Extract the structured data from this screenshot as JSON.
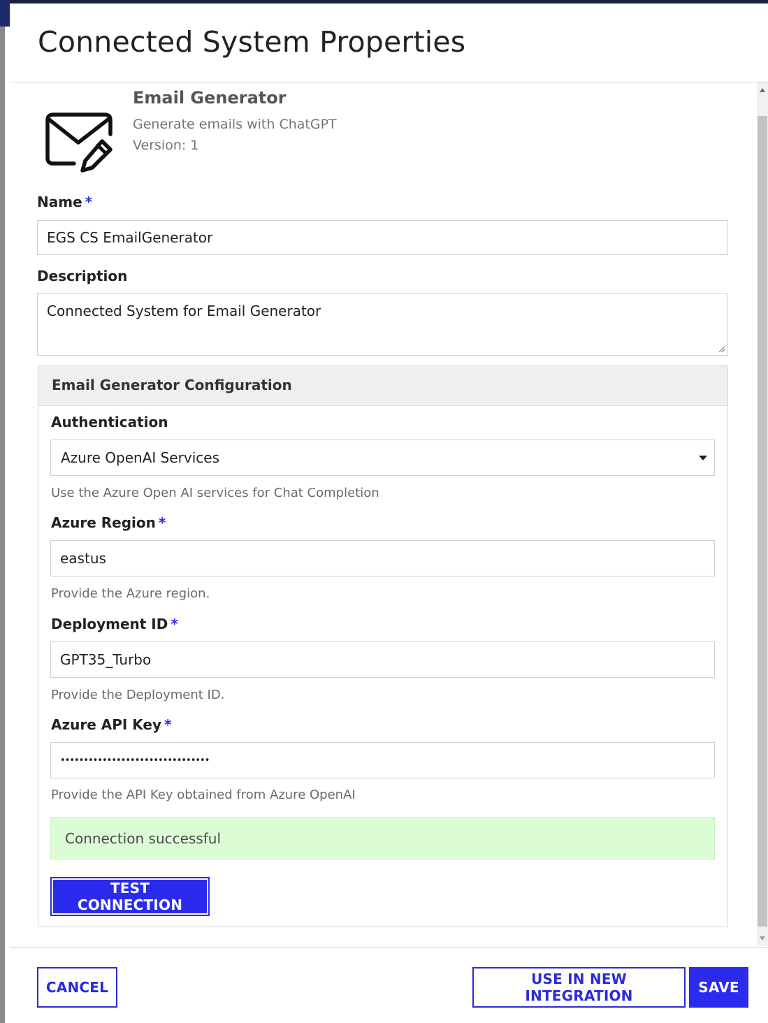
{
  "dialog": {
    "title": "Connected System Properties"
  },
  "system": {
    "icon": "envelope-pencil-icon",
    "name": "Email Generator",
    "description": "Generate emails with ChatGPT",
    "version_label": "Version: 1"
  },
  "form": {
    "name": {
      "label": "Name",
      "required_mark": "*",
      "value": "EGS CS EmailGenerator"
    },
    "description": {
      "label": "Description",
      "value": "Connected System for Email Generator"
    }
  },
  "config": {
    "title": "Email Generator Configuration",
    "authentication": {
      "label": "Authentication",
      "selected": "Azure OpenAI Services",
      "help": "Use the Azure Open AI services for Chat Completion"
    },
    "azure_region": {
      "label": "Azure Region",
      "required_mark": "*",
      "value": "eastus",
      "help": "Provide the Azure region."
    },
    "deployment_id": {
      "label": "Deployment ID",
      "required_mark": "*",
      "value": "GPT35_Turbo",
      "help": "Provide the Deployment ID."
    },
    "api_key": {
      "label": "Azure API Key",
      "required_mark": "*",
      "value": "••••••••••••••••••••••••••••••••",
      "help": "Provide the API Key obtained from Azure OpenAI"
    },
    "status_message": "Connection successful",
    "test_button": "TEST CONNECTION"
  },
  "footer": {
    "cancel": "CANCEL",
    "use_in_integration": "USE IN NEW INTEGRATION",
    "save": "SAVE"
  },
  "colors": {
    "accent": "#2b2bee",
    "success_bg": "#dcfcd6",
    "required": "#2b2bd8"
  }
}
